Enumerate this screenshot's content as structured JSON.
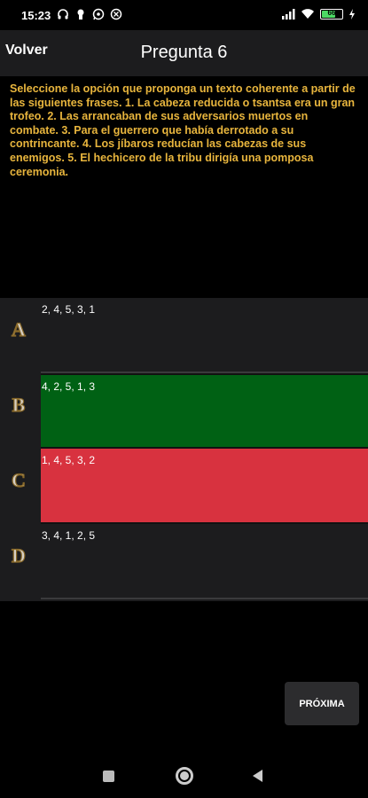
{
  "status_bar": {
    "time": "15:23",
    "battery": "66"
  },
  "header": {
    "back_label": "Volver",
    "title": "Pregunta 6"
  },
  "question": {
    "text": "Seleccione la opción que proponga un texto coherente a partir de las siguientes frases. 1. La cabeza reducida o tsantsa era un gran trofeo. 2. Las arrancaban de sus adversarios muertos en combate. 3. Para el guerrero que había derrotado a su contrincante. 4. Los jíbaros reducían las cabezas de sus enemigos. 5. El hechicero de la tribu dirigía una pomposa ceremonia."
  },
  "answers": [
    {
      "letter": "A",
      "text": "2, 4, 5, 3, 1",
      "state": "neutral"
    },
    {
      "letter": "B",
      "text": "4, 2, 5, 1, 3",
      "state": "correct"
    },
    {
      "letter": "C",
      "text": "1, 4, 5, 3, 2",
      "state": "wrong"
    },
    {
      "letter": "D",
      "text": "3, 4, 1, 2, 5",
      "state": "neutral"
    }
  ],
  "next_button": {
    "label": "PRÓXIMA"
  },
  "colors": {
    "accent_text": "#e8b53d",
    "correct": "#006114",
    "wrong": "#d8323f",
    "panel": "#1c1c1e"
  },
  "icons": [
    "headphones-icon",
    "notification-icon",
    "whatsapp-icon",
    "settings-icon",
    "signal-icon",
    "wifi-icon",
    "battery-icon",
    "charging-icon"
  ]
}
